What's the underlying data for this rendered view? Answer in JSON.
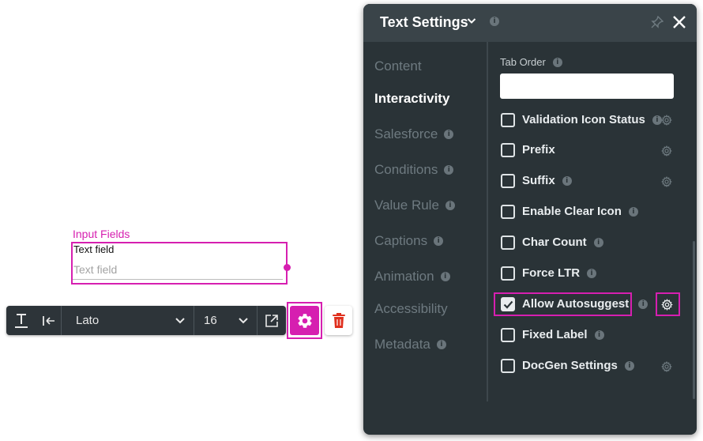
{
  "canvas": {
    "caption": "Input Fields",
    "field_label": "Text field",
    "field_placeholder": "Text field"
  },
  "toolbar": {
    "font": "Lato",
    "size": "16"
  },
  "panel": {
    "title": "Text Settings",
    "info_glyph": "i",
    "nav": [
      {
        "label": "Content",
        "active": false,
        "info": false
      },
      {
        "label": "Interactivity",
        "active": true,
        "info": false
      },
      {
        "label": "Salesforce",
        "active": false,
        "info": true
      },
      {
        "label": "Conditions",
        "active": false,
        "info": true
      },
      {
        "label": "Value Rule",
        "active": false,
        "info": true
      },
      {
        "label": "Captions",
        "active": false,
        "info": true
      },
      {
        "label": "Animation",
        "active": false,
        "info": true
      },
      {
        "label": "Accessibility",
        "active": false,
        "info": false
      },
      {
        "label": "Metadata",
        "active": false,
        "info": true
      }
    ],
    "tab_order_label": "Tab Order",
    "tab_order_value": "",
    "options": [
      {
        "label": "Validation Icon Status",
        "checked": false
      },
      {
        "label": "Prefix",
        "checked": false
      },
      {
        "label": "Suffix",
        "checked": false
      },
      {
        "label": "Enable Clear Icon",
        "checked": false
      },
      {
        "label": "Char Count",
        "checked": false
      },
      {
        "label": "Force LTR",
        "checked": false
      },
      {
        "label": "Allow Autosuggest",
        "checked": true
      },
      {
        "label": "Fixed Label",
        "checked": false
      },
      {
        "label": "DocGen Settings",
        "checked": false
      }
    ]
  },
  "colors": {
    "accent": "#d61fb0",
    "panel_bg": "#2a3337",
    "panel_header": "#3a4449",
    "toolbar_bg": "#2d3439",
    "trash": "#e0301e"
  }
}
